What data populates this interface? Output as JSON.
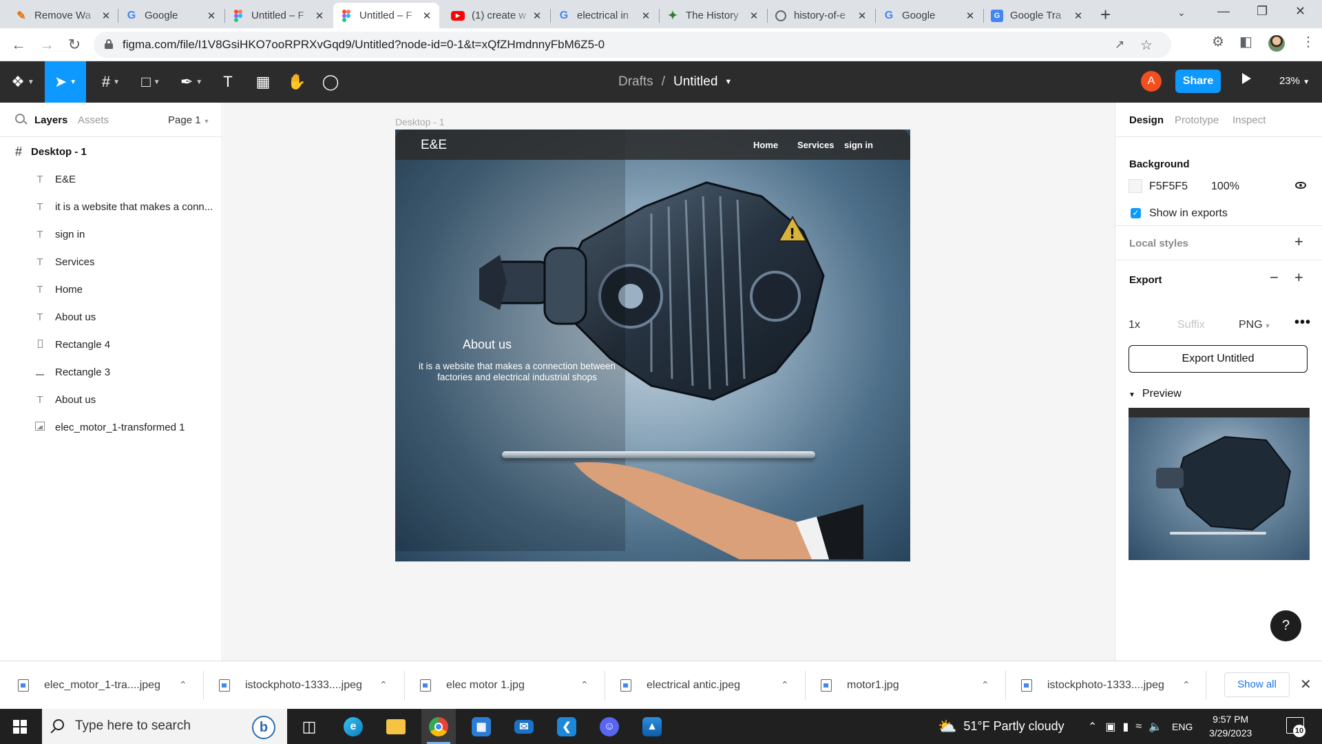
{
  "browser": {
    "tabs": [
      {
        "title": "Remove Wa",
        "icon": "remove-bg-icon",
        "active": false
      },
      {
        "title": "Google",
        "icon": "google-icon",
        "active": false
      },
      {
        "title": "Untitled – F",
        "icon": "figma-icon",
        "active": false
      },
      {
        "title": "Untitled – F",
        "icon": "figma-icon",
        "active": true
      },
      {
        "title": "(1) create w",
        "icon": "youtube-icon",
        "active": false
      },
      {
        "title": "electrical in",
        "icon": "google-icon",
        "active": false
      },
      {
        "title": "The History",
        "icon": "history-site-icon",
        "active": false
      },
      {
        "title": "history-of-e",
        "icon": "globe-icon",
        "active": false
      },
      {
        "title": "Google",
        "icon": "google-icon",
        "active": false
      },
      {
        "title": "Google Tra",
        "icon": "google-translate-icon",
        "active": false
      }
    ],
    "url": "figma.com/file/I1V8GsiHKO7ooRPRXvGqd9/Untitled?node-id=0-1&t=xQfZHmdnnyFbM6Z5-0"
  },
  "figma": {
    "breadcrumb": {
      "project": "Drafts",
      "separator": "/",
      "file": "Untitled"
    },
    "user_initial": "A",
    "share_label": "Share",
    "zoom": "23%",
    "left_panel": {
      "tabs": {
        "layers": "Layers",
        "assets": "Assets"
      },
      "page": "Page 1",
      "frame": "Desktop - 1",
      "layers": [
        {
          "name": "E&E",
          "type": "text"
        },
        {
          "name": "it is a website that makes a conn...",
          "type": "text"
        },
        {
          "name": "sign in",
          "type": "text"
        },
        {
          "name": "Services",
          "type": "text"
        },
        {
          "name": "Home",
          "type": "text"
        },
        {
          "name": "About us",
          "type": "text"
        },
        {
          "name": "Rectangle 4",
          "type": "rect"
        },
        {
          "name": "Rectangle 3",
          "type": "line"
        },
        {
          "name": "About us",
          "type": "text"
        },
        {
          "name": "elec_motor_1-transformed 1",
          "type": "image"
        }
      ]
    },
    "canvas": {
      "frame_label": "Desktop - 1",
      "site": {
        "logo": "E&E",
        "nav": {
          "home": "Home",
          "services": "Services",
          "signin": "sign in"
        },
        "about_heading": "About us",
        "about_text_line1": "it is a website that makes a connection between",
        "about_text_line2": "factories and electrical industrial shops"
      }
    },
    "right_panel": {
      "tabs": {
        "design": "Design",
        "prototype": "Prototype",
        "inspect": "Inspect"
      },
      "background": {
        "heading": "Background",
        "hex": "F5F5F5",
        "opacity": "100%",
        "show_in_exports": "Show in exports"
      },
      "local_styles": "Local styles",
      "export": {
        "heading": "Export",
        "scale": "1x",
        "suffix_placeholder": "Suffix",
        "format": "PNG",
        "button": "Export Untitled"
      },
      "preview": "Preview"
    },
    "help": "?"
  },
  "downloads": {
    "items": [
      "elec_motor_1-tra....jpeg",
      "istockphoto-1333....jpeg",
      "elec motor 1.jpg",
      "electrical antic.jpeg",
      "motor1.jpg",
      "istockphoto-1333....jpeg"
    ],
    "show_all": "Show all"
  },
  "taskbar": {
    "search_placeholder": "Type here to search",
    "weather": "51°F  Partly cloudy",
    "language": "ENG",
    "time": "9:57 PM",
    "date": "3/29/2023",
    "notifications": "10"
  },
  "colors": {
    "figma_blue": "#0d99ff",
    "figma_dark": "#2c2c2c",
    "avatar_orange": "#f24e1e",
    "canvas_bg": "#F5F5F5"
  }
}
